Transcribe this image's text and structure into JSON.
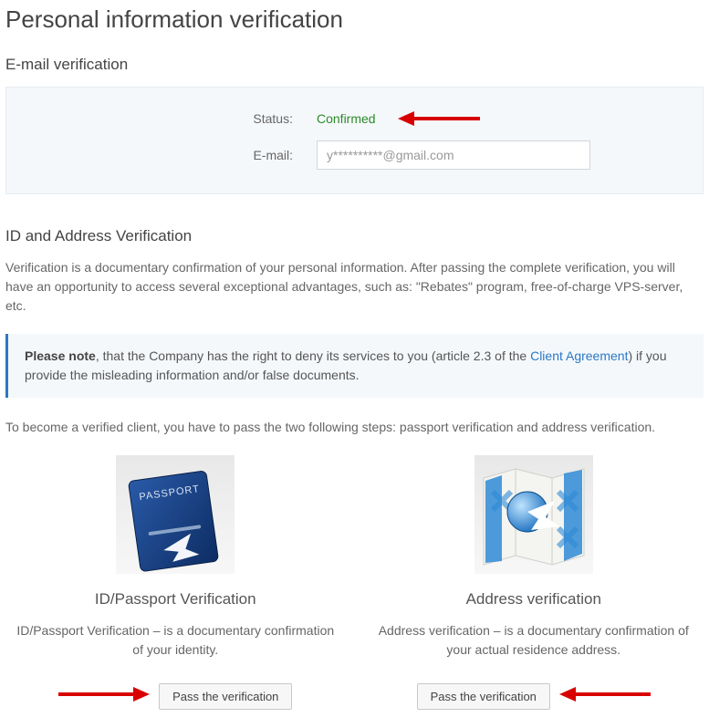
{
  "page_title": "Personal information verification",
  "email_verification": {
    "heading": "E-mail verification",
    "status_label": "Status:",
    "status_value": "Confirmed",
    "email_label": "E-mail:",
    "email_value": "y**********@gmail.com"
  },
  "id_address": {
    "heading": "ID and Address Verification",
    "intro": "Verification is a documentary confirmation of your personal information. After passing the complete verification, you will have an opportunity to access several exceptional advantages, such as: \"Rebates\" program, free-of-charge VPS-server, etc.",
    "note_prefix": "Please note",
    "note_text_1": ", that the Company has the right to deny its services to you (article 2.3 of the ",
    "note_link": "Client Agreement",
    "note_text_2": ") if you provide the misleading information and/or false documents.",
    "steps_intro": "To become a verified client, you have to pass the two following steps: passport verification and address verification."
  },
  "id_col": {
    "title": "ID/Passport Verification",
    "desc": "ID/Passport Verification – is a documentary confirmation of your identity.",
    "button": "Pass the verification"
  },
  "addr_col": {
    "title": "Address verification",
    "desc": "Address verification – is a documentary confirmation of your actual residence address.",
    "button": "Pass the verification"
  }
}
